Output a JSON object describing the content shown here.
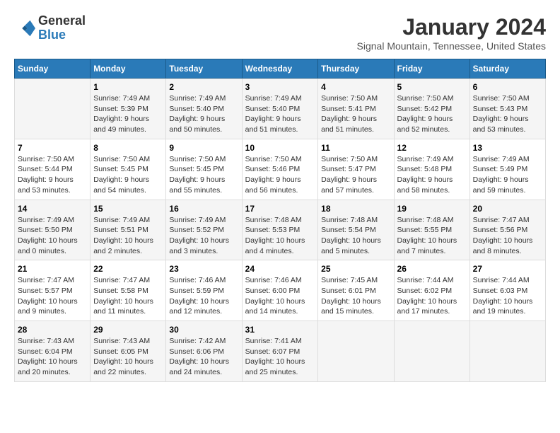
{
  "logo": {
    "general": "General",
    "blue": "Blue"
  },
  "title": "January 2024",
  "subtitle": "Signal Mountain, Tennessee, United States",
  "days_of_week": [
    "Sunday",
    "Monday",
    "Tuesday",
    "Wednesday",
    "Thursday",
    "Friday",
    "Saturday"
  ],
  "weeks": [
    [
      {
        "num": "",
        "info": ""
      },
      {
        "num": "1",
        "info": "Sunrise: 7:49 AM\nSunset: 5:39 PM\nDaylight: 9 hours\nand 49 minutes."
      },
      {
        "num": "2",
        "info": "Sunrise: 7:49 AM\nSunset: 5:40 PM\nDaylight: 9 hours\nand 50 minutes."
      },
      {
        "num": "3",
        "info": "Sunrise: 7:49 AM\nSunset: 5:40 PM\nDaylight: 9 hours\nand 51 minutes."
      },
      {
        "num": "4",
        "info": "Sunrise: 7:50 AM\nSunset: 5:41 PM\nDaylight: 9 hours\nand 51 minutes."
      },
      {
        "num": "5",
        "info": "Sunrise: 7:50 AM\nSunset: 5:42 PM\nDaylight: 9 hours\nand 52 minutes."
      },
      {
        "num": "6",
        "info": "Sunrise: 7:50 AM\nSunset: 5:43 PM\nDaylight: 9 hours\nand 53 minutes."
      }
    ],
    [
      {
        "num": "7",
        "info": "Sunrise: 7:50 AM\nSunset: 5:44 PM\nDaylight: 9 hours\nand 53 minutes."
      },
      {
        "num": "8",
        "info": "Sunrise: 7:50 AM\nSunset: 5:45 PM\nDaylight: 9 hours\nand 54 minutes."
      },
      {
        "num": "9",
        "info": "Sunrise: 7:50 AM\nSunset: 5:45 PM\nDaylight: 9 hours\nand 55 minutes."
      },
      {
        "num": "10",
        "info": "Sunrise: 7:50 AM\nSunset: 5:46 PM\nDaylight: 9 hours\nand 56 minutes."
      },
      {
        "num": "11",
        "info": "Sunrise: 7:50 AM\nSunset: 5:47 PM\nDaylight: 9 hours\nand 57 minutes."
      },
      {
        "num": "12",
        "info": "Sunrise: 7:49 AM\nSunset: 5:48 PM\nDaylight: 9 hours\nand 58 minutes."
      },
      {
        "num": "13",
        "info": "Sunrise: 7:49 AM\nSunset: 5:49 PM\nDaylight: 9 hours\nand 59 minutes."
      }
    ],
    [
      {
        "num": "14",
        "info": "Sunrise: 7:49 AM\nSunset: 5:50 PM\nDaylight: 10 hours\nand 0 minutes."
      },
      {
        "num": "15",
        "info": "Sunrise: 7:49 AM\nSunset: 5:51 PM\nDaylight: 10 hours\nand 2 minutes."
      },
      {
        "num": "16",
        "info": "Sunrise: 7:49 AM\nSunset: 5:52 PM\nDaylight: 10 hours\nand 3 minutes."
      },
      {
        "num": "17",
        "info": "Sunrise: 7:48 AM\nSunset: 5:53 PM\nDaylight: 10 hours\nand 4 minutes."
      },
      {
        "num": "18",
        "info": "Sunrise: 7:48 AM\nSunset: 5:54 PM\nDaylight: 10 hours\nand 5 minutes."
      },
      {
        "num": "19",
        "info": "Sunrise: 7:48 AM\nSunset: 5:55 PM\nDaylight: 10 hours\nand 7 minutes."
      },
      {
        "num": "20",
        "info": "Sunrise: 7:47 AM\nSunset: 5:56 PM\nDaylight: 10 hours\nand 8 minutes."
      }
    ],
    [
      {
        "num": "21",
        "info": "Sunrise: 7:47 AM\nSunset: 5:57 PM\nDaylight: 10 hours\nand 9 minutes."
      },
      {
        "num": "22",
        "info": "Sunrise: 7:47 AM\nSunset: 5:58 PM\nDaylight: 10 hours\nand 11 minutes."
      },
      {
        "num": "23",
        "info": "Sunrise: 7:46 AM\nSunset: 5:59 PM\nDaylight: 10 hours\nand 12 minutes."
      },
      {
        "num": "24",
        "info": "Sunrise: 7:46 AM\nSunset: 6:00 PM\nDaylight: 10 hours\nand 14 minutes."
      },
      {
        "num": "25",
        "info": "Sunrise: 7:45 AM\nSunset: 6:01 PM\nDaylight: 10 hours\nand 15 minutes."
      },
      {
        "num": "26",
        "info": "Sunrise: 7:44 AM\nSunset: 6:02 PM\nDaylight: 10 hours\nand 17 minutes."
      },
      {
        "num": "27",
        "info": "Sunrise: 7:44 AM\nSunset: 6:03 PM\nDaylight: 10 hours\nand 19 minutes."
      }
    ],
    [
      {
        "num": "28",
        "info": "Sunrise: 7:43 AM\nSunset: 6:04 PM\nDaylight: 10 hours\nand 20 minutes."
      },
      {
        "num": "29",
        "info": "Sunrise: 7:43 AM\nSunset: 6:05 PM\nDaylight: 10 hours\nand 22 minutes."
      },
      {
        "num": "30",
        "info": "Sunrise: 7:42 AM\nSunset: 6:06 PM\nDaylight: 10 hours\nand 24 minutes."
      },
      {
        "num": "31",
        "info": "Sunrise: 7:41 AM\nSunset: 6:07 PM\nDaylight: 10 hours\nand 25 minutes."
      },
      {
        "num": "",
        "info": ""
      },
      {
        "num": "",
        "info": ""
      },
      {
        "num": "",
        "info": ""
      }
    ]
  ]
}
